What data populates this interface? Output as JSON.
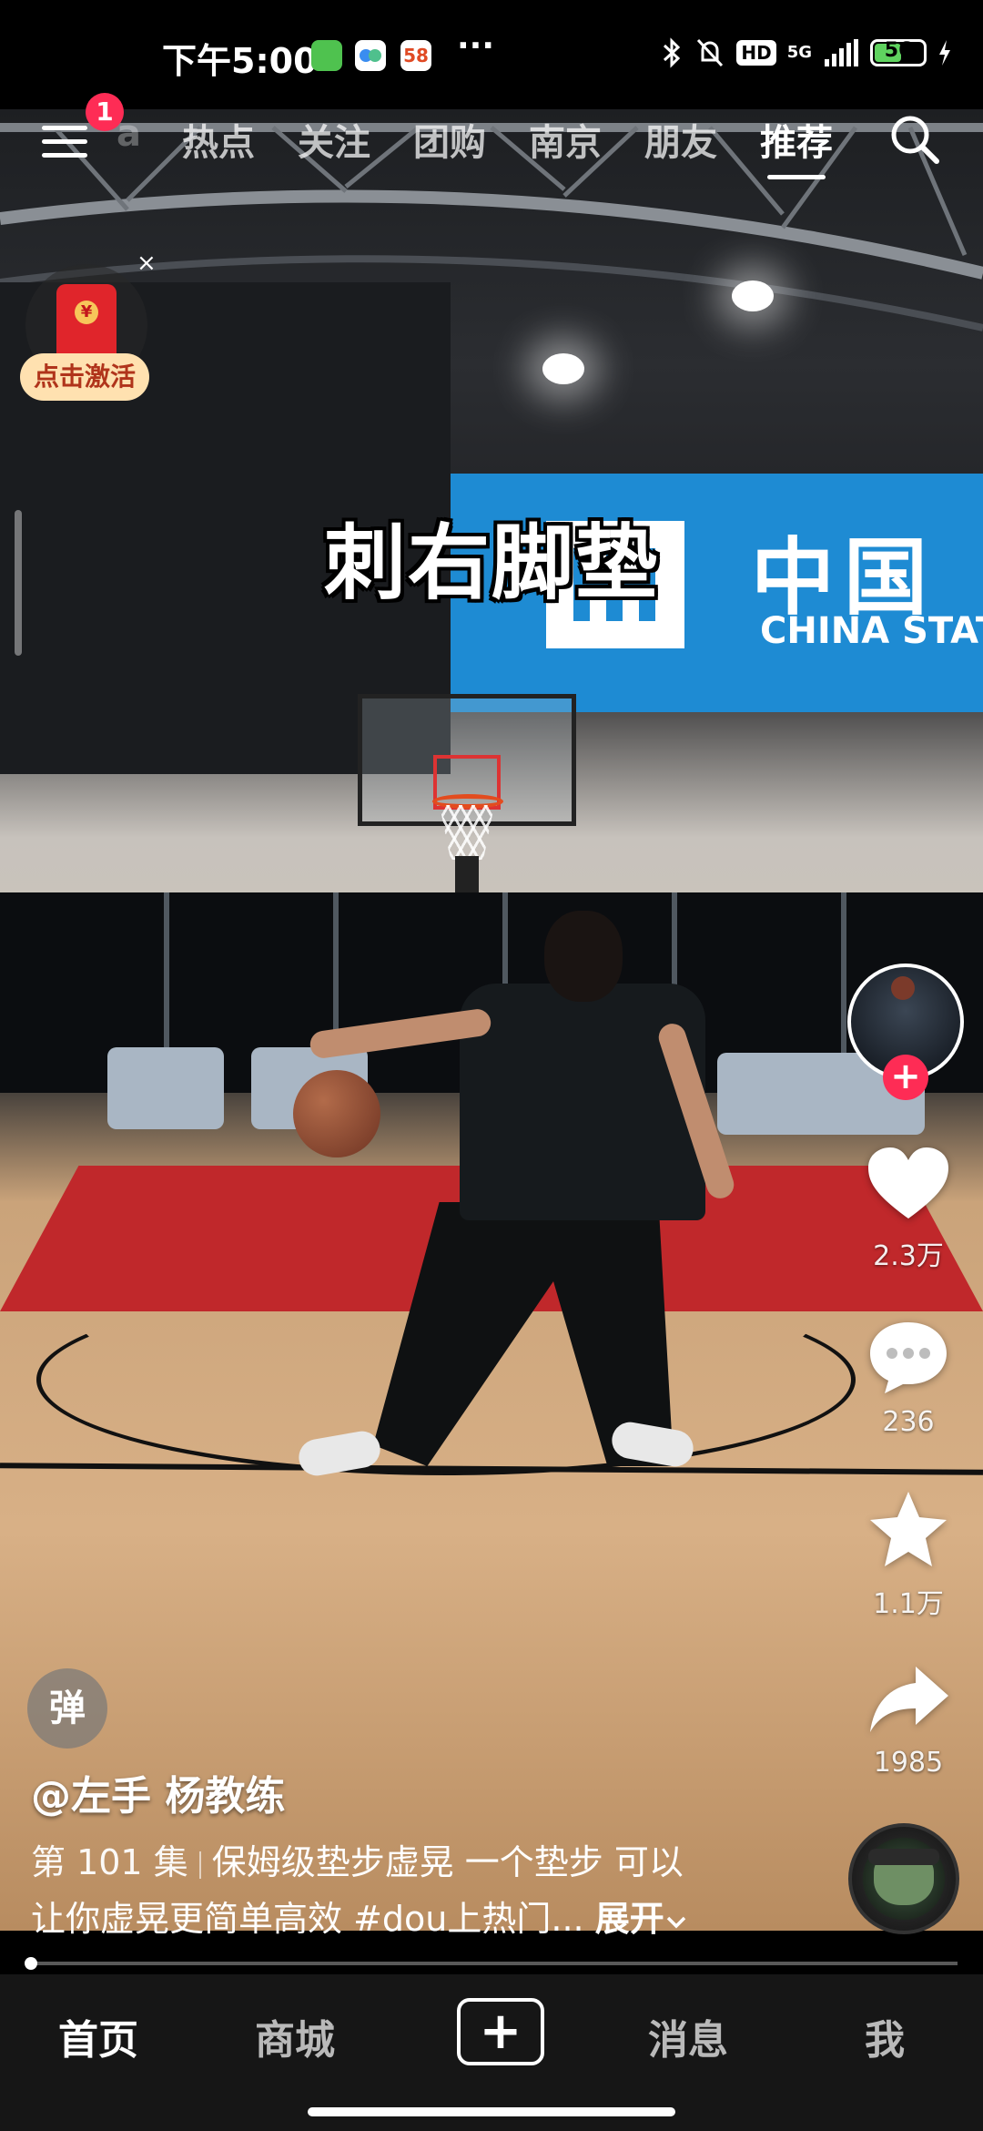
{
  "status_bar": {
    "time": "下午5:00",
    "app_icons": [
      "wechat-icon",
      "baidu-netdisk-icon",
      "58-app-icon"
    ],
    "app_icon_58_label": "58",
    "more": "···",
    "hd_label": "HD",
    "network": "5G",
    "battery_percent": "56",
    "battery_level": 0.56
  },
  "top_nav": {
    "notification_badge": "1",
    "hidden_tab": "a",
    "tabs": [
      {
        "label": "热点",
        "active": false
      },
      {
        "label": "关注",
        "active": false
      },
      {
        "label": "团购",
        "active": false
      },
      {
        "label": "南京",
        "active": false
      },
      {
        "label": "朋友",
        "active": false
      },
      {
        "label": "推荐",
        "active": true
      }
    ]
  },
  "red_packet": {
    "close": "×",
    "activate_label": "点击激活",
    "yen": "¥"
  },
  "video": {
    "overlay_caption": "刺右脚垫",
    "banner_cn": "中国",
    "banner_en": "CHINA STATE"
  },
  "actions": {
    "likes": "2.3万",
    "comments": "236",
    "favorites": "1.1万",
    "shares": "1985",
    "follow": "+"
  },
  "danmaku_label": "弹",
  "post": {
    "author": "@左手 杨教练",
    "episode": "第 101 集",
    "description_line1": "保姆级垫步虚晃 一个垫步 可以",
    "description_line2": "让你虚晃更简单高效 #dou上热门...",
    "expand_label": "展开"
  },
  "progress": {
    "played_fraction": 0.004
  },
  "bottom_nav": {
    "home": "首页",
    "mall": "商城",
    "create": "+",
    "messages": "消息",
    "me": "我"
  },
  "colors": {
    "accent": "#fe2c55",
    "bottom_bar": "#161616",
    "banner_blue": "#1e8bd3"
  }
}
